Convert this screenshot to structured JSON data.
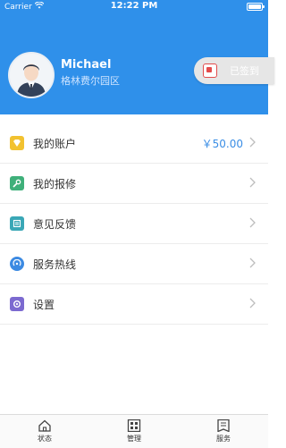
{
  "status_bar": {
    "carrier": "Carrier",
    "time": "12:22 PM"
  },
  "profile": {
    "name": "Michael",
    "location": "格林费尔园区",
    "signin_label": "已签到"
  },
  "menu": [
    {
      "label": "我的账户",
      "value": "￥50.00",
      "icon": "wallet-icon",
      "color": "#f2c230"
    },
    {
      "label": "我的报修",
      "icon": "repair-icon",
      "color": "#3fb07a"
    },
    {
      "label": "意见反馈",
      "icon": "feedback-icon",
      "color": "#3aa7b6"
    },
    {
      "label": "服务热线",
      "icon": "hotline-icon",
      "color": "#3c8ae2"
    },
    {
      "label": "设置",
      "icon": "settings-icon",
      "color": "#7c6ad0"
    }
  ],
  "tabs": [
    {
      "label": "状态",
      "icon": "home-icon"
    },
    {
      "label": "管理",
      "icon": "grid-icon"
    },
    {
      "label": "服务",
      "icon": "list-icon"
    }
  ],
  "colors": {
    "header": "#2f90ea",
    "accent": "#3b8ee5"
  }
}
